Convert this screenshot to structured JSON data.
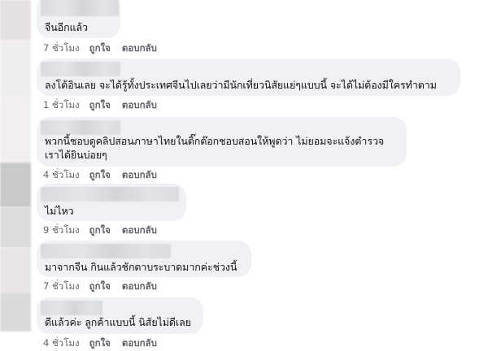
{
  "colors": {
    "bubble": "#eff1f4",
    "text": "#111111",
    "meta": "#5f6368"
  },
  "comments": [
    {
      "text": "จีนอีกแล้ว",
      "time": "7 ชั่วโมง",
      "like": "ถูกใจ",
      "reply": "ตอบกลับ"
    },
    {
      "text": "ลงโต้อินเลย จะได้รู้ทั้งประเทศจีนไปเลยว่ามีนักเที่ยวนิสัยแย่ๆแบบนี้ จะได้ไม่ต้องมีใครทำตาม",
      "time": "1 ชั่วโมง",
      "like": "ถูกใจ",
      "reply": "ตอบกลับ"
    },
    {
      "text_line1": "พวกนี้ชอบดูคลิปสอนภาษาไทยในติ๊กต๊อกชอบสอนให้พูดว่า ไม่ยอมจะแจ้งตำรวจ",
      "text_line2": "เราได้ยินบ่อยๆ",
      "time": "4 ชั่วโมง",
      "like": "ถูกใจ",
      "reply": "ตอบกลับ"
    },
    {
      "text": "ไม่ไหว",
      "time": "9 ชั่วโมง",
      "like": "ถูกใจ",
      "reply": "ตอบกลับ"
    },
    {
      "text": "มาจากจีน กินแล้วชักดาบระบาดมากค่ะช่วงนี้",
      "time": "7 ชั่วโมง",
      "like": "ถูกใจ",
      "reply": "ตอบกลับ"
    },
    {
      "text": "ดีแล้วค่ะ ลูกค้าแบบนี้ นิสัยไม่ดีเลย",
      "time": "4 ชั่วโมง",
      "like": "ถูกใจ",
      "reply": "ตอบกลับ"
    }
  ]
}
